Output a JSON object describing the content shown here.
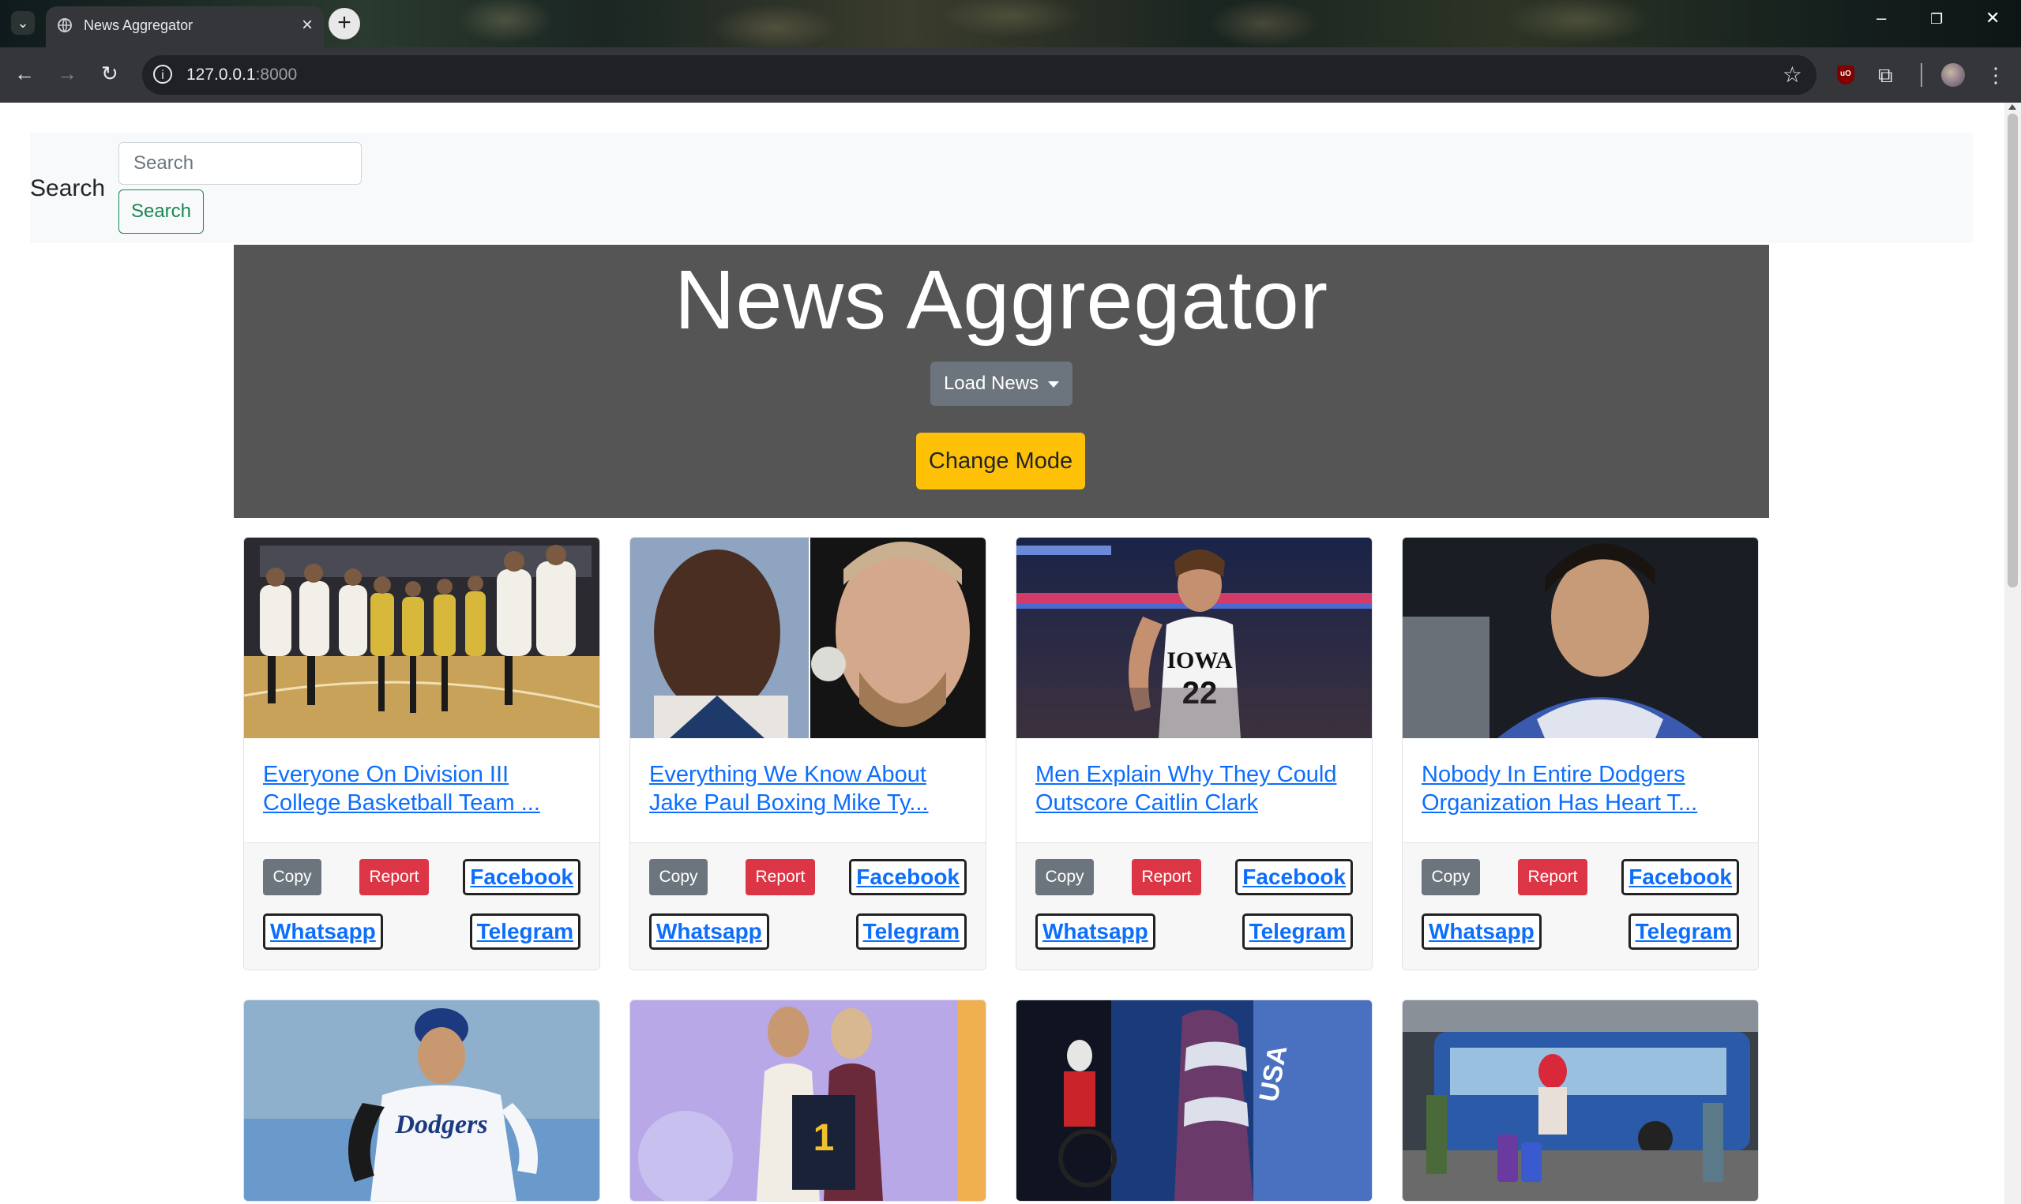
{
  "browser": {
    "tab_title": "News Aggregator",
    "url_host": "127.0.0.1",
    "url_port": ":8000"
  },
  "search": {
    "label": "Search",
    "placeholder": "Search",
    "button_label": "Search"
  },
  "header": {
    "title": "News Aggregator",
    "load_news_label": "Load News",
    "change_mode_label": "Change Mode"
  },
  "card_buttons": {
    "copy": "Copy",
    "report": "Report",
    "facebook": "Facebook",
    "whatsapp": "Whatsapp",
    "telegram": "Telegram"
  },
  "articles": [
    {
      "title": "Everyone On Division III College Basketball Team Shakes Hands Before Game",
      "display": "Everyone On Division III College Basketball Team ..."
    },
    {
      "title": "Everything We Know About Jake Paul Boxing Mike Tyson",
      "display": "Everything We Know About Jake Paul Boxing Mike Ty..."
    },
    {
      "title": "Men Explain Why They Could Outscore Caitlin Clark",
      "display": "Men Explain Why They Could Outscore Caitlin Clark"
    },
    {
      "title": "Nobody In Entire Dodgers Organization Has Heart To Tell Ohtani",
      "display": "Nobody In Entire Dodgers Organization Has Heart T..."
    }
  ],
  "colors": {
    "jumbotron": "#555555",
    "primary_link": "#0d6efd",
    "success": "#198754",
    "warning": "#ffc107",
    "danger": "#dc3545",
    "secondary": "#6c757d"
  }
}
